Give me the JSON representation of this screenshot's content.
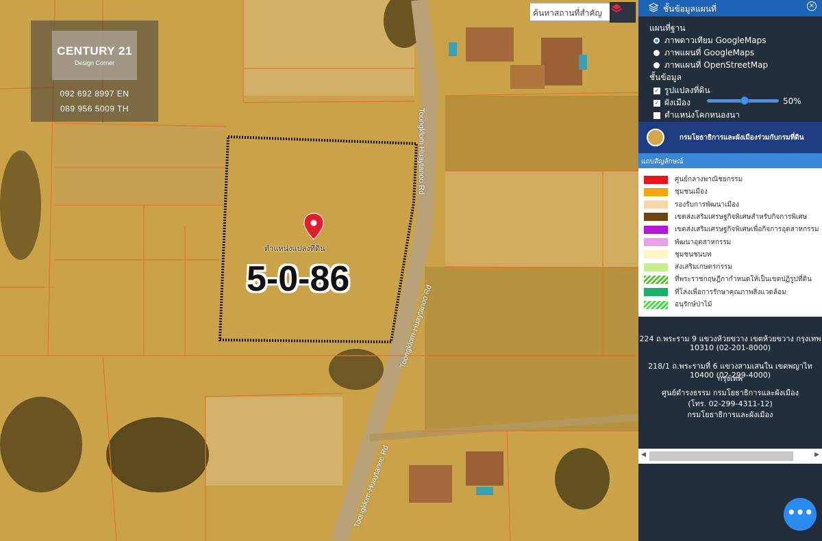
{
  "brand": {
    "name": "CENTURY 21",
    "sub": "Design Corner",
    "phone_en": "092 692 8997 EN",
    "phone_th": "089 956 5009 TH"
  },
  "map": {
    "search_placeholder": "ค้นหาสถานที่สำคัญ",
    "plot_size": "5-0-86",
    "pin_label": "ตำแหน่งแปลงที่ดิน",
    "roads": [
      "Toongklom Huaytanoo Rd",
      "Toongklom-Huaytanoo Rd",
      "Toongklom-Huaytanoo Rd"
    ]
  },
  "panel": {
    "header": "ชั้นข้อมูลแผนที่",
    "basemap_title": "แผนที่ฐาน",
    "basemaps": [
      {
        "label": "ภาพดาวเทียม GoogleMaps",
        "selected": true
      },
      {
        "label": "ภาพแผนที่ GoogleMaps",
        "selected": false
      },
      {
        "label": "ภาพแผนที่ OpenStreetMap",
        "selected": false
      }
    ],
    "layer_title": "ชั้นข้อมูล",
    "layers": [
      {
        "label": "รูปแปลงที่ดิน",
        "checked": true
      },
      {
        "label": "ผังเมือง",
        "checked": true
      },
      {
        "label": "ตำแหน่งโคกหนองนา",
        "checked": false
      }
    ],
    "opacity": "50%",
    "dept": "กรมโยธาธิการและผังเมืองร่วมกับกรมที่ดิน",
    "legend_title": "แถบสัญลักษณ์",
    "legend": [
      {
        "label": "ศูนย์กลางพาณิชยกรรม",
        "color": "#e8161b"
      },
      {
        "label": "ชุมชนเมือง",
        "color": "#f5a416"
      },
      {
        "label": "รองรับการพัฒนาเมือง",
        "color": "#f7d7a3"
      },
      {
        "label": "เขตส่งเสริมเศรษฐกิจพิเศษสำหรับกิจการพิเศษ",
        "color": "#6b4410"
      },
      {
        "label": "เขตส่งเสริมเศรษฐกิจพิเศษเพื่อกิจการอุตสาหกรรม",
        "color": "#b516d8"
      },
      {
        "label": "พัฒนาอุตสาหกรรม",
        "color": "#e5a3e6"
      },
      {
        "label": "ชุมชนชนบท",
        "color": "#fbf7c4"
      },
      {
        "label": "ส่งเสริมเกษตรกรรม",
        "color": "#c6f08a"
      },
      {
        "label": "ที่พระราชกฤษฎีกากำหนดให้เป็นเขตปฏิรูปที่ดิน",
        "color": "#5cbf2a"
      },
      {
        "label": "ที่โล่งเพื่อการรักษาคุณภาพสิ่งแวดล้อม",
        "color": "#1bb06a"
      },
      {
        "label": "อนุรักษ์ป่าไม้",
        "color": "#3fdc3f"
      }
    ],
    "address1_line1": "224 ถ.พระราม 9 แขวงห้วยขวาง เขตห้วยขวาง กรุงเทพ",
    "address1_line2": "10310 (02-201-8000)",
    "address2_line1": "218/1 ถ.พระรามที่ 6 แขวงสามเสนใน เขตพญาไท กรุงเทพ",
    "address2_line2": "10400 (02-299-4000)",
    "center_line1": "ศูนย์ดำรงธรรม กรมโยธาธิการและผังเมือง",
    "center_line2": "(โทร. 02-299-4311-12)",
    "center_line3": "กรมโยธาธิการและผังเมือง",
    "fab": "•••"
  }
}
